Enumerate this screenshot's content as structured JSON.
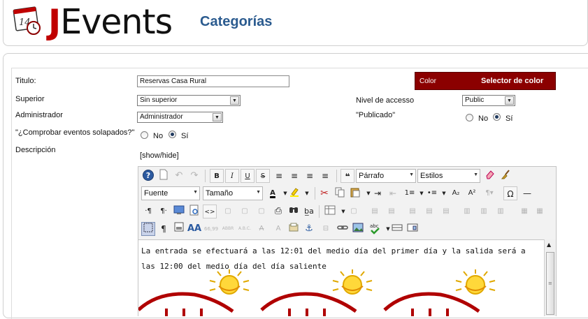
{
  "header": {
    "logo_j": "J",
    "logo_rest": "Events",
    "calendar_day": "14",
    "page_title": "Categorías"
  },
  "colors": {
    "title_blue": "#2b5b8f",
    "logo_red": "#c00000",
    "color_button_bg": "#8b0000"
  },
  "form": {
    "titulo": {
      "label": "Titulo:",
      "value": "Reservas Casa Rural"
    },
    "superior": {
      "label": "Superior",
      "value": "Sin superior"
    },
    "administrador": {
      "label": "Administrador",
      "value": "Administrador"
    },
    "solapados": {
      "label": "\"¿Comprobar eventos solapados?\"",
      "no": "No",
      "si": "Sí",
      "selected": "Sí"
    },
    "descripcion": {
      "label": "Descripción",
      "show_hide": "[show/hide]"
    },
    "color": {
      "label": "Color",
      "picker": "Selector de color"
    },
    "nivel_acceso": {
      "label": "Nivel de accesso",
      "value": "Public"
    },
    "publicado": {
      "label": "\"Publicado\"",
      "no": "No",
      "si": "Sí",
      "selected": "Sí"
    }
  },
  "editor": {
    "format_select": "Párrafo",
    "styles_select": "Estilos",
    "font_select": "Fuente",
    "size_select": "Tamaño",
    "content": "La entrada se efectuará a las 12:01 del medio día del primer día y la salida será a las 12:00 del medio día del día saliente",
    "toolbar_icons": [
      "help-icon",
      "new-document-icon",
      "undo-icon",
      "redo-icon",
      "bold-icon",
      "italic-icon",
      "underline-icon",
      "strikethrough-icon",
      "align-justify-icon",
      "align-center-icon",
      "align-left-icon",
      "align-right-icon",
      "blockquote-icon",
      "cleanup-icon",
      "brush-icon",
      "font-color-icon",
      "highlight-icon",
      "cut-icon",
      "copy-icon",
      "paste-icon",
      "indent-icon",
      "outdent-icon",
      "numbered-list-icon",
      "bullet-list-icon",
      "subscript-icon",
      "superscript-icon",
      "special-char-icon",
      "horizontal-rule-icon",
      "ltr-icon",
      "rtl-icon",
      "fullscreen-icon",
      "preview-icon",
      "code-icon",
      "print-icon",
      "find-icon",
      "replace-icon",
      "table-icon",
      "visual-aid-icon",
      "paragraph-icon",
      "abbr-icon",
      "acronym-icon",
      "spellcheck-icon",
      "image-icon",
      "anchor-icon",
      "link-icon",
      "attribs-icon",
      "style-icon"
    ]
  }
}
